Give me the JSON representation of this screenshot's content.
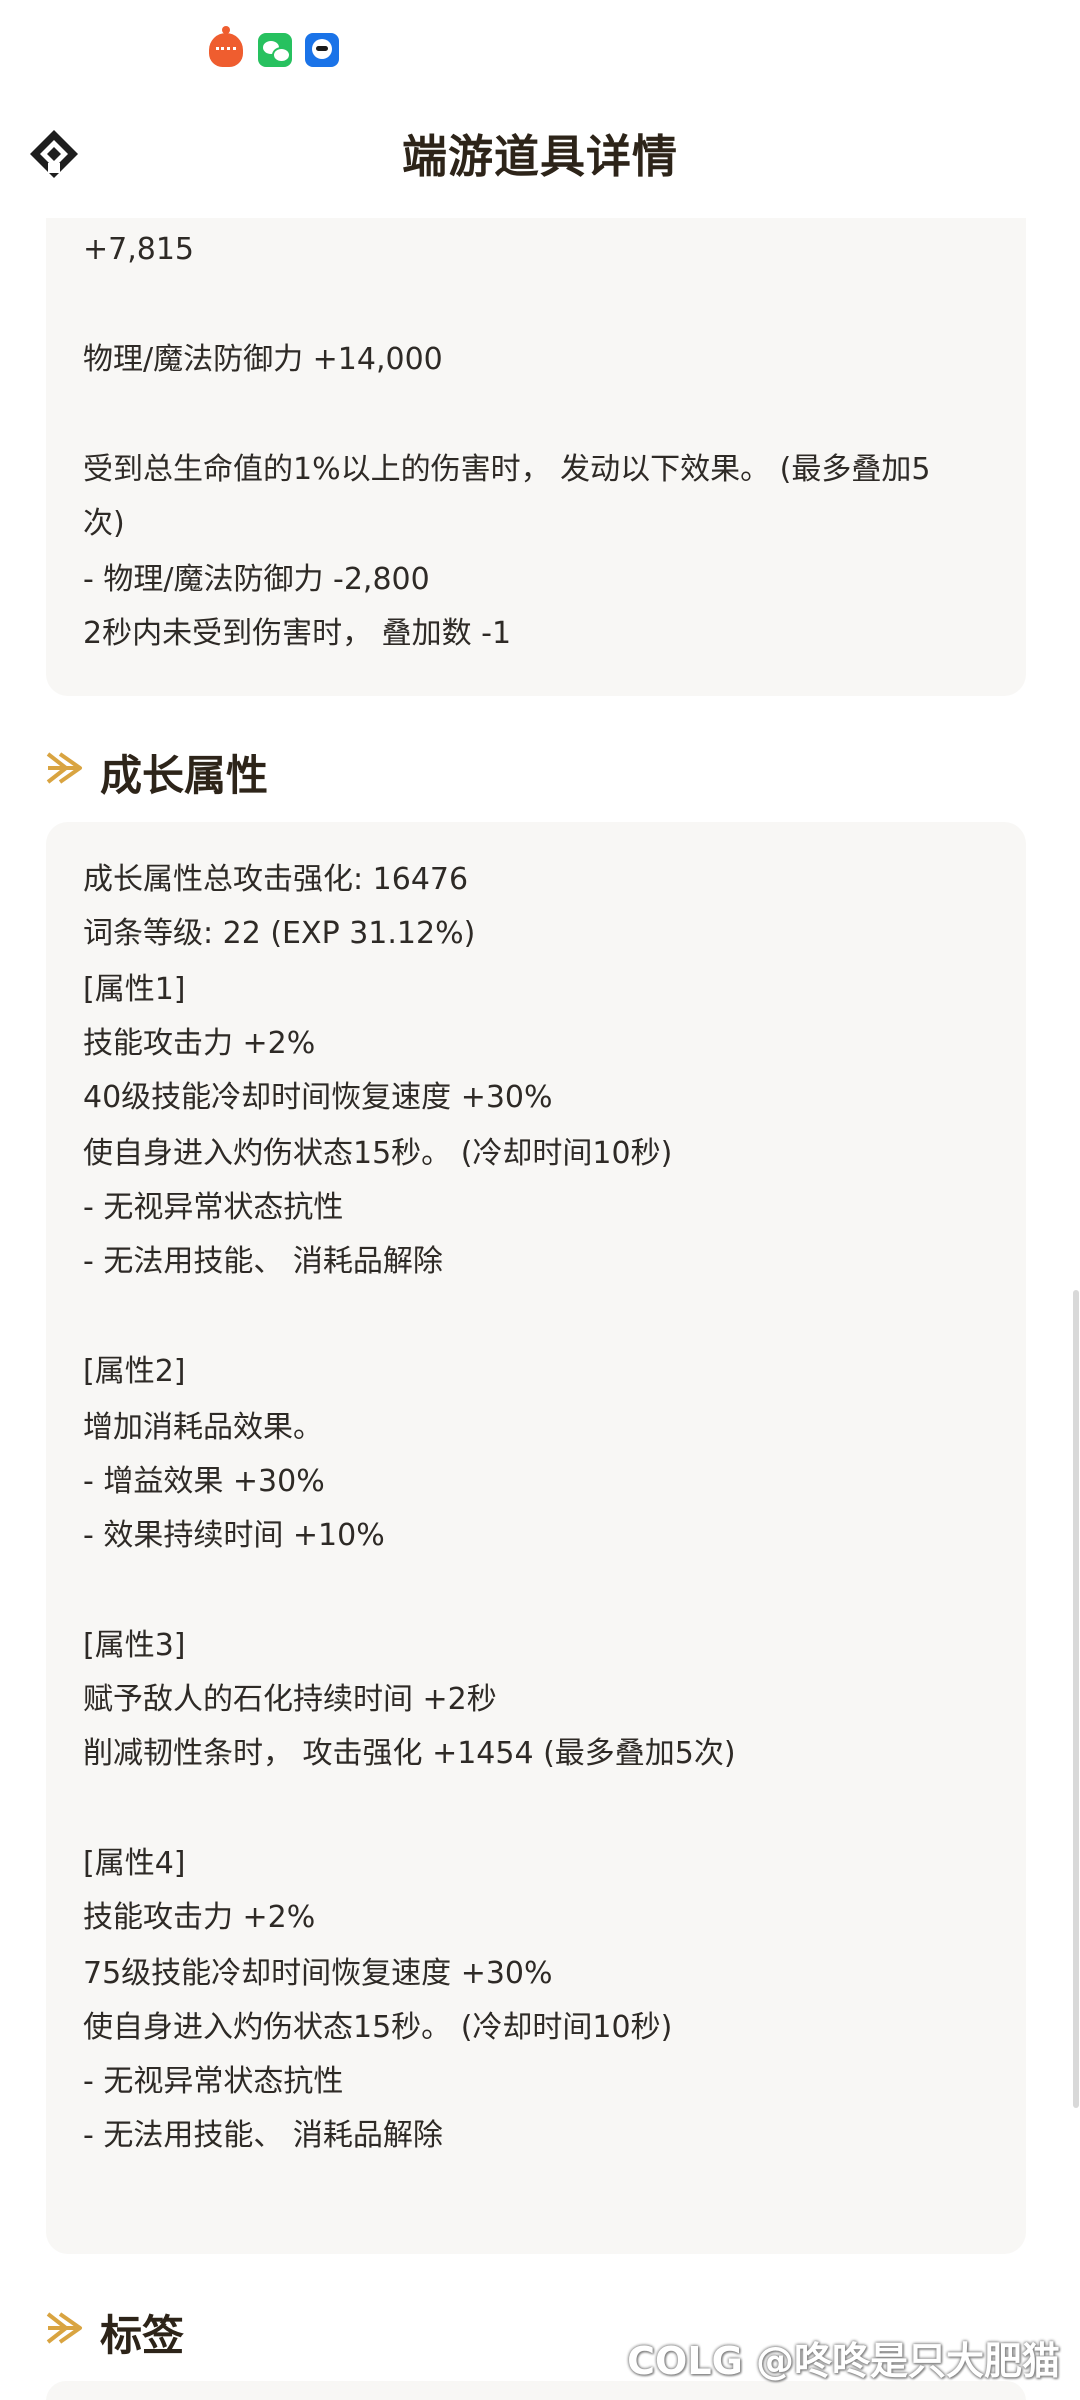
{
  "status_bar": {
    "icons": [
      "notification-app-icon",
      "wechat-icon",
      "qq-icon"
    ]
  },
  "header": {
    "title": "端游道具详情",
    "logo": "diamond-logo-icon"
  },
  "top_card": {
    "lines": [
      "+7,815",
      "",
      "物理/魔法防御力 +14,000",
      "",
      "受到总生命值的1%以上的伤害时， 发动以下效果。 (最多叠加5",
      "次)",
      "- 物理/魔法防御力 -2,800",
      "2秒内未受到伤害时， 叠加数 -1"
    ]
  },
  "growth_section": {
    "title": "成长属性",
    "lines": [
      "成长属性总攻击强化: 16476",
      "词条等级: 22 (EXP 31.12%)",
      "[属性1]",
      "技能攻击力 +2%",
      "40级技能冷却时间恢复速度 +30%",
      "使自身进入灼伤状态15秒。 (冷却时间10秒)",
      "- 无视异常状态抗性",
      "- 无法用技能、 消耗品解除",
      "",
      "[属性2]",
      "增加消耗品效果。",
      "- 增益效果 +30%",
      "- 效果持续时间 +10%",
      "",
      "[属性3]",
      "赋予敌人的石化持续时间 +2秒",
      "削减韧性条时， 攻击强化 +1454 (最多叠加5次)",
      "",
      "[属性4]",
      "技能攻击力 +2%",
      "75级技能冷却时间恢复速度 +30%",
      "使自身进入灼伤状态15秒。 (冷却时间10秒)",
      "- 无视异常状态抗性",
      "- 无法用技能、 消耗品解除"
    ]
  },
  "tags_section": {
    "title": "标签"
  },
  "watermark": "COLG @咚咚是只大肥猫",
  "colors": {
    "accent": "#d9a441",
    "card_background": "#f8f7f5",
    "heading_text": "#2d2419",
    "body_text": "#2e2a26"
  }
}
